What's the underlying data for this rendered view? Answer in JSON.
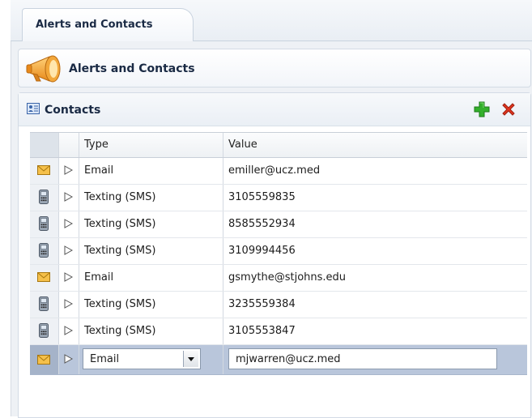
{
  "tab": {
    "label": "Alerts and Contacts"
  },
  "header": {
    "title": "Alerts and Contacts",
    "icon": "megaphone-icon"
  },
  "panel": {
    "title": "Contacts",
    "icon": "contacts-card-icon",
    "add_icon": "plus-icon",
    "delete_icon": "delete-x-icon",
    "accent_add": "#2fa52a",
    "accent_delete": "#d9301c"
  },
  "table": {
    "columns": [
      "Type",
      "Value"
    ],
    "rows": [
      {
        "icon": "email-envelope-icon",
        "type": "Email",
        "value": "emiller@ucz.med"
      },
      {
        "icon": "mobile-phone-icon",
        "type": "Texting (SMS)",
        "value": "3105559835"
      },
      {
        "icon": "mobile-phone-icon",
        "type": "Texting (SMS)",
        "value": "8585552934"
      },
      {
        "icon": "mobile-phone-icon",
        "type": "Texting (SMS)",
        "value": "3109994456"
      },
      {
        "icon": "email-envelope-icon",
        "type": "Email",
        "value": "gsmythe@stjohns.edu"
      },
      {
        "icon": "mobile-phone-icon",
        "type": "Texting (SMS)",
        "value": "3235559384"
      },
      {
        "icon": "mobile-phone-icon",
        "type": "Texting (SMS)",
        "value": "3105553847"
      }
    ],
    "edit_row": {
      "icon": "email-envelope-icon",
      "type": "Email",
      "value": "mjwarren@ucz.med"
    },
    "selected_color": "#b9c6db"
  }
}
